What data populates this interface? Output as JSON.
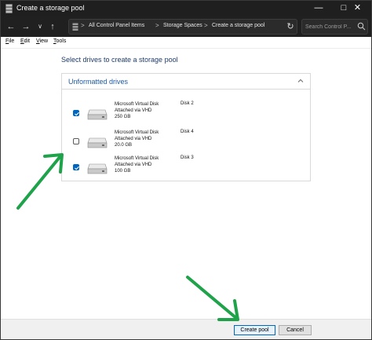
{
  "window": {
    "title": "Create a storage pool",
    "controls": [
      "minimize",
      "maximize",
      "close"
    ]
  },
  "navigation": {
    "buttons": [
      "back",
      "forward",
      "recent-locations",
      "up"
    ],
    "breadcrumbs": [
      "All Control Panel Items",
      "Storage Spaces",
      "Create a storage pool"
    ],
    "separator": ">",
    "search_placeholder": "Search Control P..."
  },
  "menubar": {
    "items": [
      {
        "accel": "F",
        "rest": "ile"
      },
      {
        "accel": "E",
        "rest": "dit"
      },
      {
        "accel": "V",
        "rest": "iew"
      },
      {
        "accel": "T",
        "rest": "ools"
      }
    ]
  },
  "main": {
    "heading": "Select drives to create a storage pool",
    "group": {
      "title": "Unformatted drives",
      "drives": [
        {
          "name": "Microsoft Virtual Disk",
          "attach": "Attached via VHD",
          "size": "250 GB",
          "label": "Disk 2",
          "checked": true
        },
        {
          "name": "Microsoft Virtual Disk",
          "attach": "Attached via VHD",
          "size": "20.0 GB",
          "label": "Disk 4",
          "checked": false
        },
        {
          "name": "Microsoft Virtual Disk",
          "attach": "Attached via VHD",
          "size": "100 GB",
          "label": "Disk 3",
          "checked": true
        }
      ]
    }
  },
  "footer": {
    "create_label": "Create pool",
    "cancel_label": "Cancel"
  },
  "colors": {
    "accent": "#0067c0",
    "annotation_arrow": "#1fa34a",
    "heading": "#1e3b6b"
  }
}
